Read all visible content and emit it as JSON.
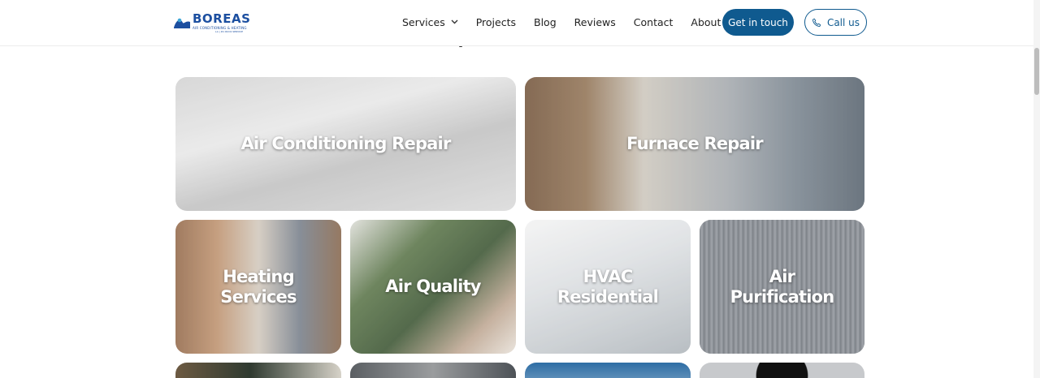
{
  "brand": {
    "name": "BOREAS",
    "tagline": "AIR CONDITIONING & HEATING",
    "subline": "LA | #1 RUCK SERVICE",
    "color": "#1c4fa0"
  },
  "nav": {
    "items": [
      {
        "label": "Services",
        "has_dropdown": true
      },
      {
        "label": "Projects"
      },
      {
        "label": "Blog"
      },
      {
        "label": "Reviews"
      },
      {
        "label": "Contact"
      },
      {
        "label": "About Us"
      }
    ],
    "cta_primary": "Get in touch",
    "cta_secondary": "Call us",
    "accent_color": "#0f5a8f"
  },
  "services": {
    "cards": [
      {
        "title": "Air Conditioning Repair"
      },
      {
        "title": "Furnace Repair"
      },
      {
        "title": "Heating Services"
      },
      {
        "title": "Air Quality"
      },
      {
        "title": "HVAC Residential"
      },
      {
        "title": "Air Purification"
      }
    ]
  }
}
